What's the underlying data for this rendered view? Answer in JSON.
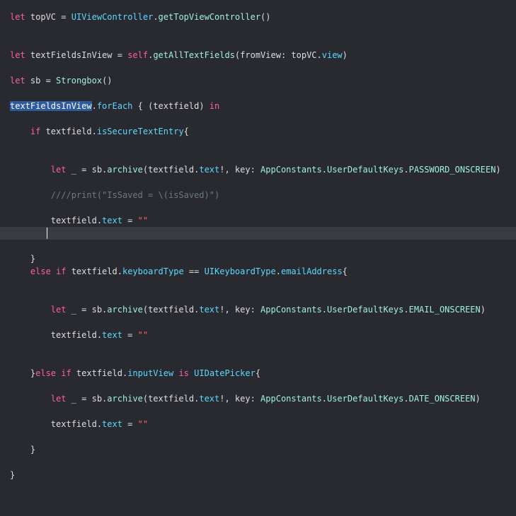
{
  "editor": {
    "lines": [
      {
        "tokens": [
          [
            "let",
            "kw"
          ],
          [
            " topVC = ",
            "plain"
          ],
          [
            "UIViewController",
            "type"
          ],
          [
            ".",
            "plain"
          ],
          [
            "getTopViewController",
            "func"
          ],
          [
            "()",
            "plain"
          ]
        ]
      },
      {
        "tokens": [
          [
            "let",
            "kw"
          ],
          [
            " textFieldsInView = ",
            "plain"
          ],
          [
            "self",
            "kw"
          ],
          [
            ".",
            "plain"
          ],
          [
            "getAllTextFields",
            "func"
          ],
          [
            "(fromView: topVC.",
            "plain"
          ],
          [
            "view",
            "prop"
          ],
          [
            ")",
            "plain"
          ]
        ]
      },
      {
        "tokens": [
          [
            "let",
            "kw"
          ],
          [
            " sb = ",
            "plain"
          ],
          [
            "Strongbox",
            "func"
          ],
          [
            "()",
            "plain"
          ]
        ]
      },
      {
        "tokens": [
          [
            "textFieldsInView",
            "sel"
          ],
          [
            ".",
            "plain"
          ],
          [
            "forEach",
            "prop"
          ],
          [
            " { (textfield) ",
            "plain"
          ],
          [
            "in",
            "kw"
          ]
        ]
      },
      {
        "tokens": [
          [
            "    ",
            "plain"
          ],
          [
            "if",
            "kw"
          ],
          [
            " textfield.",
            "plain"
          ],
          [
            "isSecureTextEntry",
            "prop"
          ],
          [
            "{",
            "plain"
          ]
        ]
      },
      {
        "tokens": [
          [
            "        ",
            "plain"
          ],
          [
            "let",
            "kw"
          ],
          [
            " _ = sb.",
            "plain"
          ],
          [
            "archive",
            "func"
          ],
          [
            "(textfield.",
            "plain"
          ],
          [
            "text",
            "prop"
          ],
          [
            "!, key: ",
            "plain"
          ],
          [
            "AppConstants",
            "func"
          ],
          [
            ".",
            "plain"
          ],
          [
            "UserDefaultKeys",
            "func"
          ],
          [
            ".",
            "plain"
          ],
          [
            "PASSWORD_ONSCREEN",
            "func"
          ],
          [
            ")",
            "plain"
          ]
        ]
      },
      {
        "tokens": [
          [
            "        ",
            "plain"
          ],
          [
            "////print(\"IsSaved = \\(isSaved)\")",
            "cmt"
          ]
        ]
      },
      {
        "tokens": [
          [
            "        textfield.",
            "plain"
          ],
          [
            "text",
            "prop"
          ],
          [
            " = ",
            "plain"
          ],
          [
            "\"\"",
            "str"
          ]
        ]
      },
      {
        "tokens": [
          [
            "    }",
            "plain"
          ]
        ]
      },
      {
        "tokens": [
          [
            "    ",
            "plain"
          ],
          [
            "else if",
            "kw"
          ],
          [
            " textfield.",
            "plain"
          ],
          [
            "keyboardType",
            "prop"
          ],
          [
            " == ",
            "plain"
          ],
          [
            "UIKeyboardType",
            "type"
          ],
          [
            ".",
            "plain"
          ],
          [
            "emailAddress",
            "prop"
          ],
          [
            "{",
            "plain"
          ]
        ]
      },
      {
        "tokens": [
          [
            "        ",
            "plain"
          ],
          [
            "let",
            "kw"
          ],
          [
            " _ = sb.",
            "plain"
          ],
          [
            "archive",
            "func"
          ],
          [
            "(textfield.",
            "plain"
          ],
          [
            "text",
            "prop"
          ],
          [
            "!, key: ",
            "plain"
          ],
          [
            "AppConstants",
            "func"
          ],
          [
            ".",
            "plain"
          ],
          [
            "UserDefaultKeys",
            "func"
          ],
          [
            ".",
            "plain"
          ],
          [
            "EMAIL_ONSCREEN",
            "func"
          ],
          [
            ")",
            "plain"
          ]
        ]
      },
      {
        "tokens": [
          [
            "        textfield.",
            "plain"
          ],
          [
            "text",
            "prop"
          ],
          [
            " = ",
            "plain"
          ],
          [
            "\"\"",
            "str"
          ]
        ]
      },
      {
        "tokens": [
          [
            "    }",
            "plain"
          ],
          [
            "else if",
            "kw"
          ],
          [
            " textfield.",
            "plain"
          ],
          [
            "inputView",
            "prop"
          ],
          [
            " ",
            "plain"
          ],
          [
            "is",
            "kw"
          ],
          [
            " ",
            "plain"
          ],
          [
            "UIDatePicker",
            "type"
          ],
          [
            "{",
            "plain"
          ]
        ]
      },
      {
        "tokens": [
          [
            "        ",
            "plain"
          ],
          [
            "let",
            "kw"
          ],
          [
            " _ = sb.",
            "plain"
          ],
          [
            "archive",
            "func"
          ],
          [
            "(textfield.",
            "plain"
          ],
          [
            "text",
            "prop"
          ],
          [
            "!, key: ",
            "plain"
          ],
          [
            "AppConstants",
            "func"
          ],
          [
            ".",
            "plain"
          ],
          [
            "UserDefaultKeys",
            "func"
          ],
          [
            ".",
            "plain"
          ],
          [
            "DATE_ONSCREEN",
            "func"
          ],
          [
            ")",
            "plain"
          ]
        ]
      },
      {
        "tokens": [
          [
            "        textfield.",
            "plain"
          ],
          [
            "text",
            "prop"
          ],
          [
            " = ",
            "plain"
          ],
          [
            "\"\"",
            "str"
          ]
        ]
      },
      {
        "tokens": [
          [
            "    }",
            "plain"
          ]
        ]
      },
      {
        "tokens": [
          [
            "}",
            "plain"
          ]
        ]
      }
    ]
  }
}
